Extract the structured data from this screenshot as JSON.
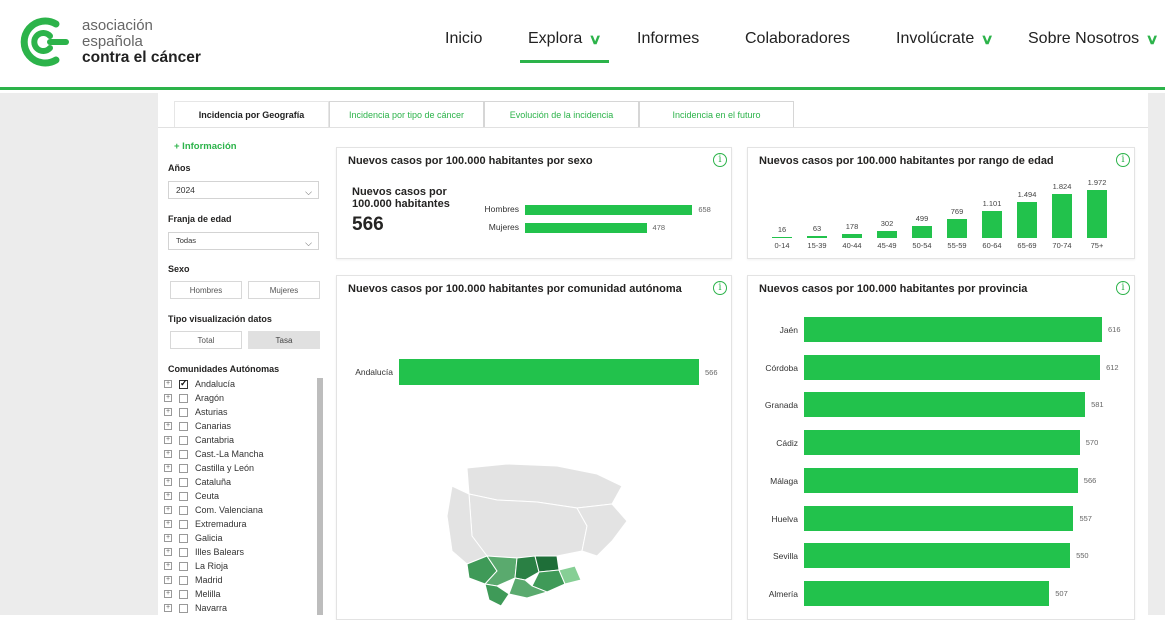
{
  "brand": {
    "line1": "asociación",
    "line2": "española",
    "line3": "contra el cáncer",
    "color": "#2cb34a"
  },
  "nav": {
    "inicio": "Inicio",
    "explora": "Explora",
    "informes": "Informes",
    "colaboradores": "Colaboradores",
    "involucrate": "Involúcrate",
    "sobre": "Sobre Nosotros",
    "chevron": "chevron-down-icon"
  },
  "tabs": [
    "Incidencia por Geografía",
    "Incidencia por tipo de cáncer",
    "Evolución de la incidencia",
    "Incidencia en el futuro"
  ],
  "sidebar": {
    "info_link": "+ Información",
    "years_label": "Años",
    "years_value": "2024",
    "age_label": "Franja de edad",
    "age_value": "Todas",
    "sex_label": "Sexo",
    "sex_options": [
      "Hombres",
      "Mujeres"
    ],
    "viz_label": "Tipo visualización datos",
    "viz_options": [
      "Total",
      "Tasa"
    ],
    "viz_selected": "Tasa",
    "communities_label": "Comunidades Autónomas",
    "communities": [
      {
        "name": "Andalucía",
        "checked": true
      },
      {
        "name": "Aragón",
        "checked": false
      },
      {
        "name": "Asturias",
        "checked": false
      },
      {
        "name": "Canarias",
        "checked": false
      },
      {
        "name": "Cantabria",
        "checked": false
      },
      {
        "name": "Cast.-La Mancha",
        "checked": false
      },
      {
        "name": "Castilla y León",
        "checked": false
      },
      {
        "name": "Cataluña",
        "checked": false
      },
      {
        "name": "Ceuta",
        "checked": false
      },
      {
        "name": "Com. Valenciana",
        "checked": false
      },
      {
        "name": "Extremadura",
        "checked": false
      },
      {
        "name": "Galicia",
        "checked": false
      },
      {
        "name": "Illes Balears",
        "checked": false
      },
      {
        "name": "La Rioja",
        "checked": false
      },
      {
        "name": "Madrid",
        "checked": false
      },
      {
        "name": "Melilla",
        "checked": false
      },
      {
        "name": "Navarra",
        "checked": false
      }
    ]
  },
  "cards": {
    "sex": {
      "title": "Nuevos casos por 100.000 habitantes por sexo",
      "kpi_label": "Nuevos casos por 100.000 habitantes",
      "kpi_value": "566"
    },
    "age": {
      "title": "Nuevos casos por 100.000 habitantes por rango de edad"
    },
    "community": {
      "title": "Nuevos casos por 100.000 habitantes por comunidad autónoma"
    },
    "province": {
      "title": "Nuevos casos por 100.000 habitantes por provincia"
    }
  },
  "chart_data": [
    {
      "type": "bar",
      "orientation": "horizontal",
      "categories": [
        "Hombres",
        "Mujeres"
      ],
      "values": [
        658,
        478
      ],
      "labels": [
        "658",
        "478"
      ],
      "xlim": [
        0,
        700
      ]
    },
    {
      "type": "bar",
      "categories": [
        "0-14",
        "15-39",
        "40-44",
        "45-49",
        "50-54",
        "55-59",
        "60-64",
        "65-69",
        "70-74",
        "75+"
      ],
      "values": [
        16,
        63,
        178,
        302,
        499,
        769,
        1101,
        1494,
        1824,
        1972
      ],
      "labels": [
        "16",
        "63",
        "178",
        "302",
        "499",
        "769",
        "1.101",
        "1.494",
        "1.824",
        "1.972"
      ],
      "ylim": [
        0,
        1972
      ]
    },
    {
      "type": "bar",
      "orientation": "horizontal",
      "categories": [
        "Andalucía"
      ],
      "values": [
        566
      ],
      "labels": [
        "566"
      ],
      "xlim": [
        0,
        566
      ]
    },
    {
      "type": "bar",
      "orientation": "horizontal",
      "categories": [
        "Jaén",
        "Córdoba",
        "Granada",
        "Cádiz",
        "Málaga",
        "Huelva",
        "Sevilla",
        "Almería"
      ],
      "values": [
        616,
        612,
        581,
        570,
        566,
        557,
        550,
        507
      ],
      "labels": [
        "616",
        "612",
        "581",
        "570",
        "566",
        "557",
        "550",
        "507"
      ],
      "xlim": [
        0,
        616
      ]
    }
  ],
  "colors": {
    "bar": "#22c24c",
    "accent": "#2cb34a",
    "map_base": "#e3e3e3",
    "map_dark": "#1e6e38",
    "map_mid": "#3f9a58",
    "map_light": "#86cf95"
  }
}
